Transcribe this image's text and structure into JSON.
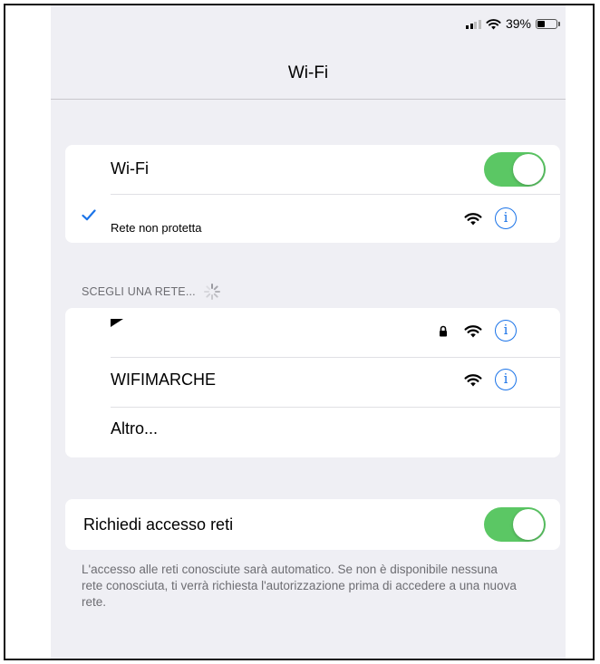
{
  "status_bar": {
    "battery_text": "39%",
    "battery_level": 0.39
  },
  "nav": {
    "title": "Wi-Fi"
  },
  "wifi_group": {
    "toggle_label": "Wi-Fi",
    "toggle_on": true,
    "connected_network": "Rete non protetta"
  },
  "networks_section": {
    "header": "SCEGLI UNA RETE...",
    "networks": [
      {
        "name": "",
        "secured": true
      },
      {
        "name": "WIFIMARCHE",
        "secured": false
      }
    ],
    "other_label": "Altro..."
  },
  "ask_join": {
    "label": "Richiedi accesso reti",
    "toggle_on": true,
    "description": "L'accesso alle reti conosciute sarà automatico. Se non è disponibile nessuna rete conosciuta, ti verrà richiesta l'autorizzazione prima di accedere a una nuova rete."
  },
  "colors": {
    "toggle_on": "#5bc764",
    "accent": "#1a73e8",
    "background": "#efeff4"
  },
  "icons": [
    "signal-icon",
    "wifi-icon",
    "battery-icon",
    "checkmark-icon",
    "info-icon",
    "lock-icon",
    "spinner-icon"
  ]
}
